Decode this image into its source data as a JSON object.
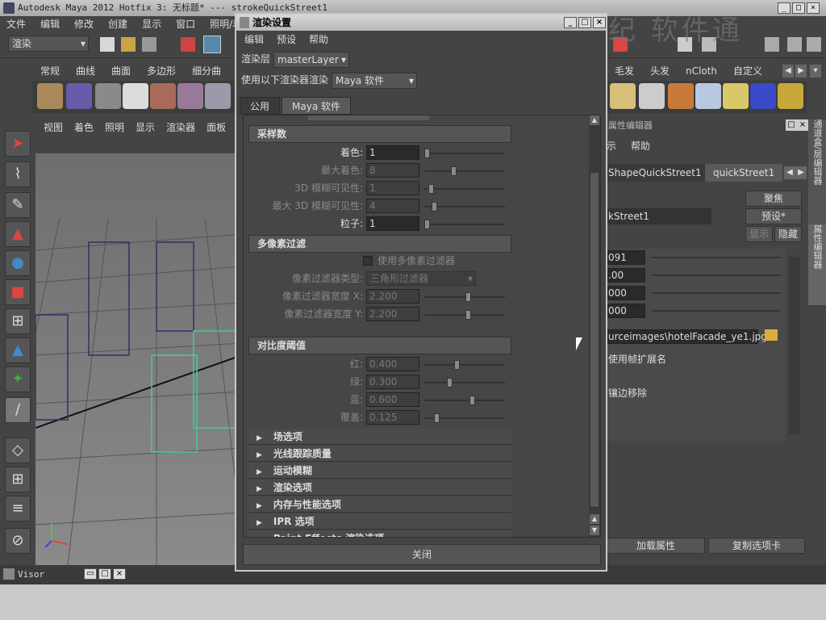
{
  "app": {
    "title": "Autodesk Maya 2012 Hotfix 3: 无标题*   ---   strokeQuickStreet1",
    "menu": [
      "文件",
      "编辑",
      "修改",
      "创建",
      "显示",
      "窗口",
      "照明/着色"
    ],
    "mode_combo": "渲染",
    "shelf_tabs": [
      "常规",
      "曲线",
      "曲面",
      "多边形",
      "细分曲"
    ],
    "shelf_tabs_right": [
      "毛发",
      "头发",
      "nCloth",
      "自定义"
    ],
    "watermark": "中新世纪 软件通"
  },
  "viewport": {
    "menu": [
      "视图",
      "着色",
      "照明",
      "显示",
      "渲染器",
      "面板"
    ]
  },
  "dialog": {
    "title": "渲染设置",
    "menu": [
      "编辑",
      "预设",
      "帮助"
    ],
    "render_layer_label": "渲染层",
    "render_layer_value": "masterLayer",
    "renderer_label": "使用以下渲染器渲染",
    "renderer_value": "Maya 软件",
    "tabs": [
      "公用",
      "Maya 软件"
    ],
    "sections": {
      "sampling": {
        "title": "采样数",
        "fields": [
          {
            "label": "着色:",
            "value": "1",
            "enabled": true,
            "knob": 0
          },
          {
            "label": "最大着色:",
            "value": "8",
            "enabled": false,
            "knob": 0.35
          },
          {
            "label": "3D 模糊可见性:",
            "value": "1",
            "enabled": false,
            "knob": 0.05
          },
          {
            "label": "最大 3D 模糊可见性:",
            "value": "4",
            "enabled": false,
            "knob": 0.1
          },
          {
            "label": "粒子:",
            "value": "1",
            "enabled": true,
            "knob": 0
          }
        ]
      },
      "multipixel": {
        "title": "多像素过滤",
        "checkbox_label": "使用多像素过滤器",
        "filter_type_label": "像素过滤器类型:",
        "filter_type_value": "三角形过滤器",
        "fields": [
          {
            "label": "像素过滤器宽度 X:",
            "value": "2.200",
            "enabled": false,
            "knob": 0.55
          },
          {
            "label": "像素过滤器宽度 Y:",
            "value": "2.200",
            "enabled": false,
            "knob": 0.55
          }
        ]
      },
      "contrast": {
        "title": "对比度阈值",
        "fields": [
          {
            "label": "红:",
            "value": "0.400",
            "enabled": false,
            "knob": 0.4
          },
          {
            "label": "绿:",
            "value": "0.300",
            "enabled": false,
            "knob": 0.3
          },
          {
            "label": "蓝:",
            "value": "0.600",
            "enabled": false,
            "knob": 0.6
          },
          {
            "label": "覆盖:",
            "value": "0.125",
            "enabled": false,
            "knob": 0.125
          }
        ]
      }
    },
    "collapsed_sections": [
      "场选项",
      "光线跟踪质量",
      "运动模糊",
      "渲染选项",
      "内存与性能选项",
      "IPR 选项",
      "Paint Effects 渲染选项"
    ],
    "close_button": "关闭"
  },
  "attribute_editor": {
    "title": "属性编辑器",
    "menu": [
      "示",
      "帮助"
    ],
    "tabs": [
      "ShapeQuickStreet1",
      "quickStreet1"
    ],
    "node_name": "kStreet1",
    "focus_button": "聚焦",
    "preset_button": "预设*",
    "show_button": "显示",
    "hide_button": "隐藏",
    "values": [
      "091",
      ".00",
      "000",
      "000"
    ],
    "file_path": "urceimages\\hotelFacade_ye1.jpg",
    "use_frame_ext": "使用帧扩展名",
    "edge_remove": "镶边移除",
    "load_attr_button": "加载属性",
    "copy_tab_button": "复制选项卡",
    "side_tabs": [
      "通道盒/层编辑器",
      "属性编辑器"
    ]
  },
  "visor": {
    "title": "Visor"
  }
}
